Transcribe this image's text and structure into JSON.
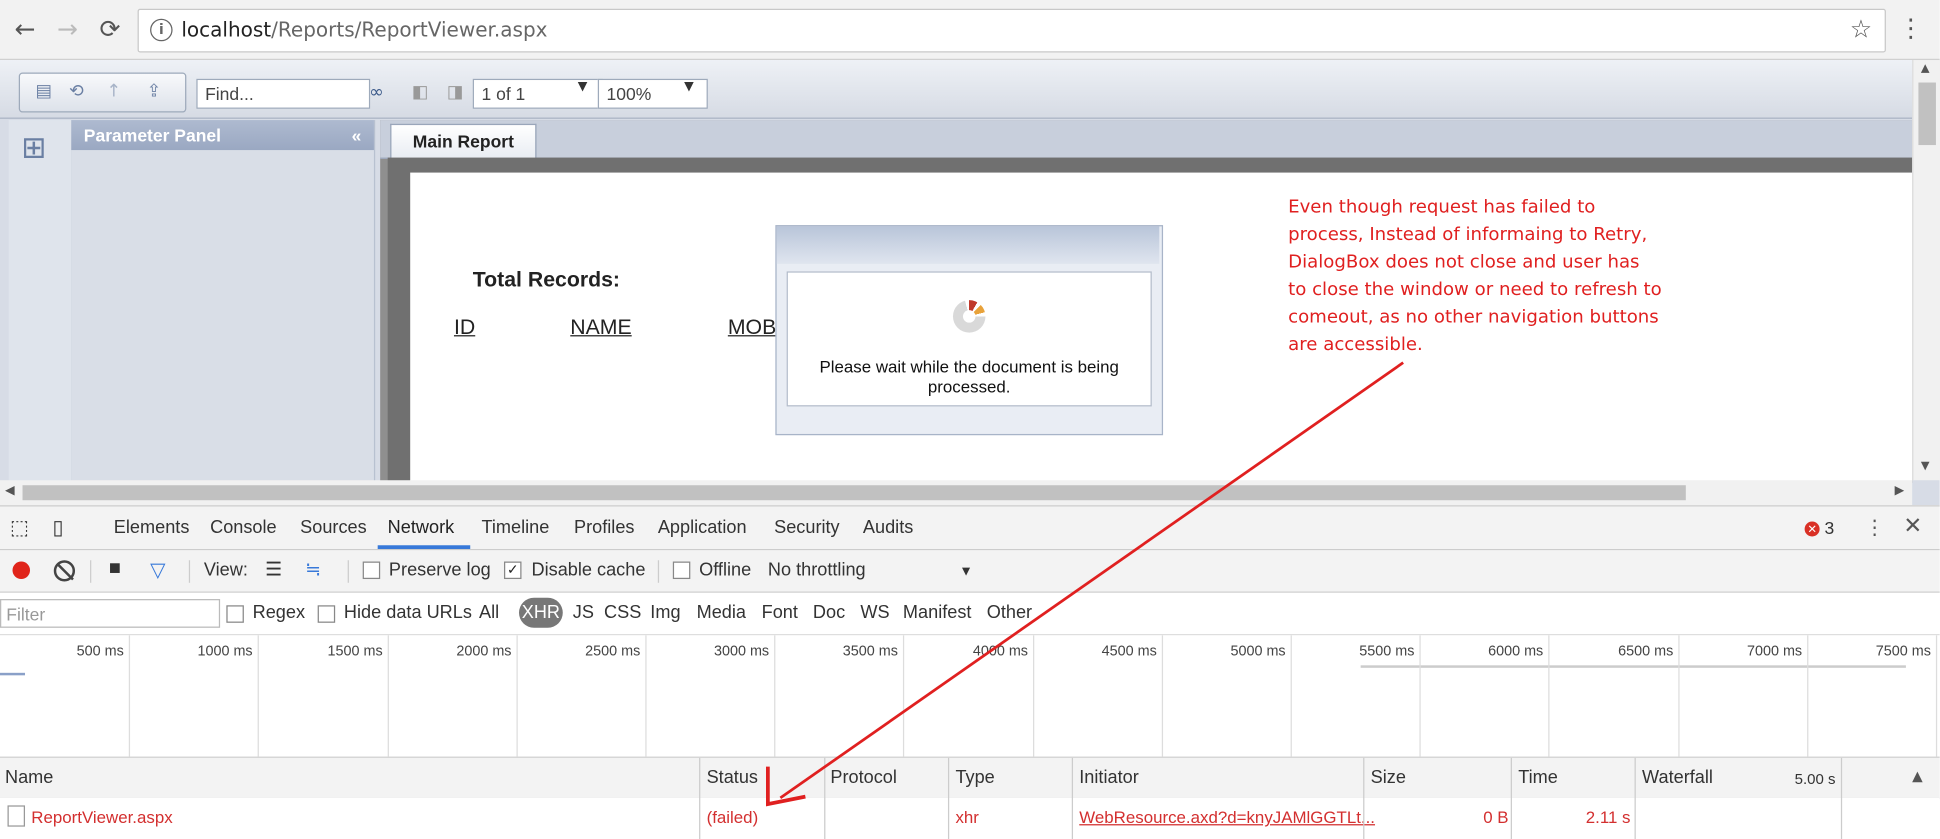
{
  "browser": {
    "url_host": "localhost",
    "url_path": "/Reports/ReportViewer.aspx",
    "back_glyph": "←",
    "forward_glyph": "→",
    "reload_glyph": "⟳",
    "info_glyph": "i",
    "star_glyph": "☆",
    "menu_glyph": "⋮"
  },
  "report_viewer": {
    "toolbar": {
      "find_placeholder": "Find...",
      "page_value": "1 of 1",
      "zoom_value": "100%",
      "icons": [
        "print-icon",
        "refresh-icon",
        "parent-report-icon",
        "export-icon",
        "find-binoculars-icon",
        "first-page-icon",
        "previous-page-icon"
      ]
    },
    "parameter_panel": {
      "title": "Parameter Panel",
      "collapse_glyph": "«"
    },
    "tabs": [
      {
        "label": "Main Report"
      }
    ],
    "report": {
      "total_records_label": "Total Records:",
      "columns": [
        "ID",
        "NAME",
        "MOB"
      ]
    },
    "loading_dialog": {
      "message": "Please wait while the document is being processed."
    }
  },
  "annotation": {
    "text": "Even though request has failed to process, Instead of informaing to Retry, DialogBox does not close and user has to close the window or need to refresh to comeout, as no other navigation buttons are accessible.",
    "color": "#e02020"
  },
  "devtools": {
    "tabs": [
      "Elements",
      "Console",
      "Sources",
      "Network",
      "Timeline",
      "Profiles",
      "Application",
      "Security",
      "Audits"
    ],
    "active_tab": "Network",
    "error_count": "3",
    "toolbar": {
      "view_label": "View:",
      "preserve_log": "Preserve log",
      "preserve_log_checked": false,
      "disable_cache": "Disable cache",
      "disable_cache_checked": true,
      "offline": "Offline",
      "offline_checked": false,
      "throttling": "No throttling"
    },
    "filterbar": {
      "filter_placeholder": "Filter",
      "regex": "Regex",
      "hide_data_urls": "Hide data URLs",
      "types": [
        "All",
        "XHR",
        "JS",
        "CSS",
        "Img",
        "Media",
        "Font",
        "Doc",
        "WS",
        "Manifest",
        "Other"
      ],
      "active_type": "XHR"
    },
    "timeline_ticks": [
      "500 ms",
      "1000 ms",
      "1500 ms",
      "2000 ms",
      "2500 ms",
      "3000 ms",
      "3500 ms",
      "4000 ms",
      "4500 ms",
      "5000 ms",
      "5500 ms",
      "6000 ms",
      "6500 ms",
      "7000 ms",
      "7500 ms"
    ],
    "table": {
      "columns": [
        "Name",
        "Status",
        "Protocol",
        "Type",
        "Initiator",
        "Size",
        "Time",
        "Waterfall"
      ],
      "waterfall_scale": "5.00 s",
      "rows": [
        {
          "name": "ReportViewer.aspx",
          "status": "(failed)",
          "protocol": "",
          "type": "xhr",
          "initiator": "WebResource.axd?d=knyJAMlGGTLt...",
          "size": "0 B",
          "time": "2.11 s"
        }
      ]
    },
    "accent_color": "#3879d9",
    "error_color": "#d32f2f"
  }
}
